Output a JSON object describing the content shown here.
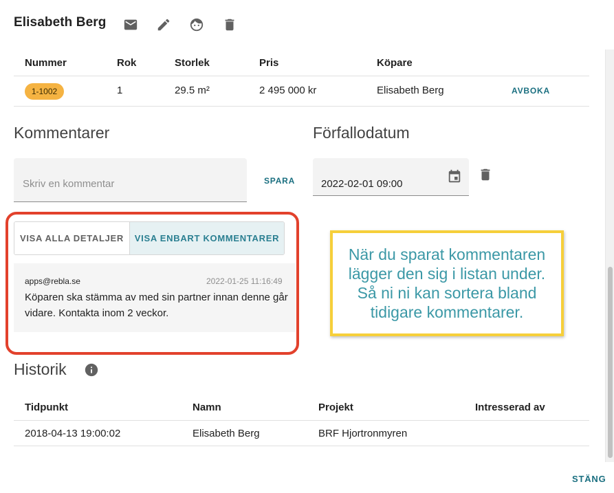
{
  "header": {
    "title": "Elisabeth Berg",
    "icons": [
      "mail-icon",
      "edit-icon",
      "face-icon",
      "delete-icon"
    ]
  },
  "units_table": {
    "headers": [
      "Nummer",
      "Rok",
      "Storlek",
      "Pris",
      "Köpare"
    ],
    "row": {
      "nummer": "1-1002",
      "rok": "1",
      "storlek": "29.5 m²",
      "pris": "2 495 000 kr",
      "kopare": "Elisabeth Berg",
      "action": "AVBOKA"
    }
  },
  "comments": {
    "title": "Kommentarer",
    "placeholder": "Skriv en kommentar",
    "save_label": "SPARA",
    "toggle": {
      "all_details": "VISA ALLA DETALJER",
      "only_comments": "VISA ENBART KOMMENTARER",
      "selected": "only_comments"
    },
    "items": [
      {
        "author": "apps@rebla.se",
        "date": "2022-01-25 11:16:49",
        "text": "Köparen ska stämma av med sin partner innan denne går vidare. Kontakta inom 2 veckor."
      }
    ]
  },
  "due_date": {
    "title": "Förfallodatum",
    "value": "2022-02-01 09:00"
  },
  "callout": {
    "text": "När du sparat kommentaren lägger den sig i listan under. Så ni ni kan sortera bland tidigare kommentarer."
  },
  "history": {
    "title": "Historik",
    "headers": [
      "Tidpunkt",
      "Namn",
      "Projekt",
      "Intresserad av"
    ],
    "rows": [
      {
        "tidpunkt": "2018-04-13 19:00:02",
        "namn": "Elisabeth Berg",
        "projekt": "BRF Hjortronmyren",
        "intresserad_av": ""
      }
    ]
  },
  "footer": {
    "close_label": "STÄNG"
  },
  "colors": {
    "accent": "#1a6f80",
    "badge": "#f5b342",
    "highlight_red": "#e2412c",
    "callout_border": "#f6cf3a",
    "callout_text": "#3b98a6"
  }
}
